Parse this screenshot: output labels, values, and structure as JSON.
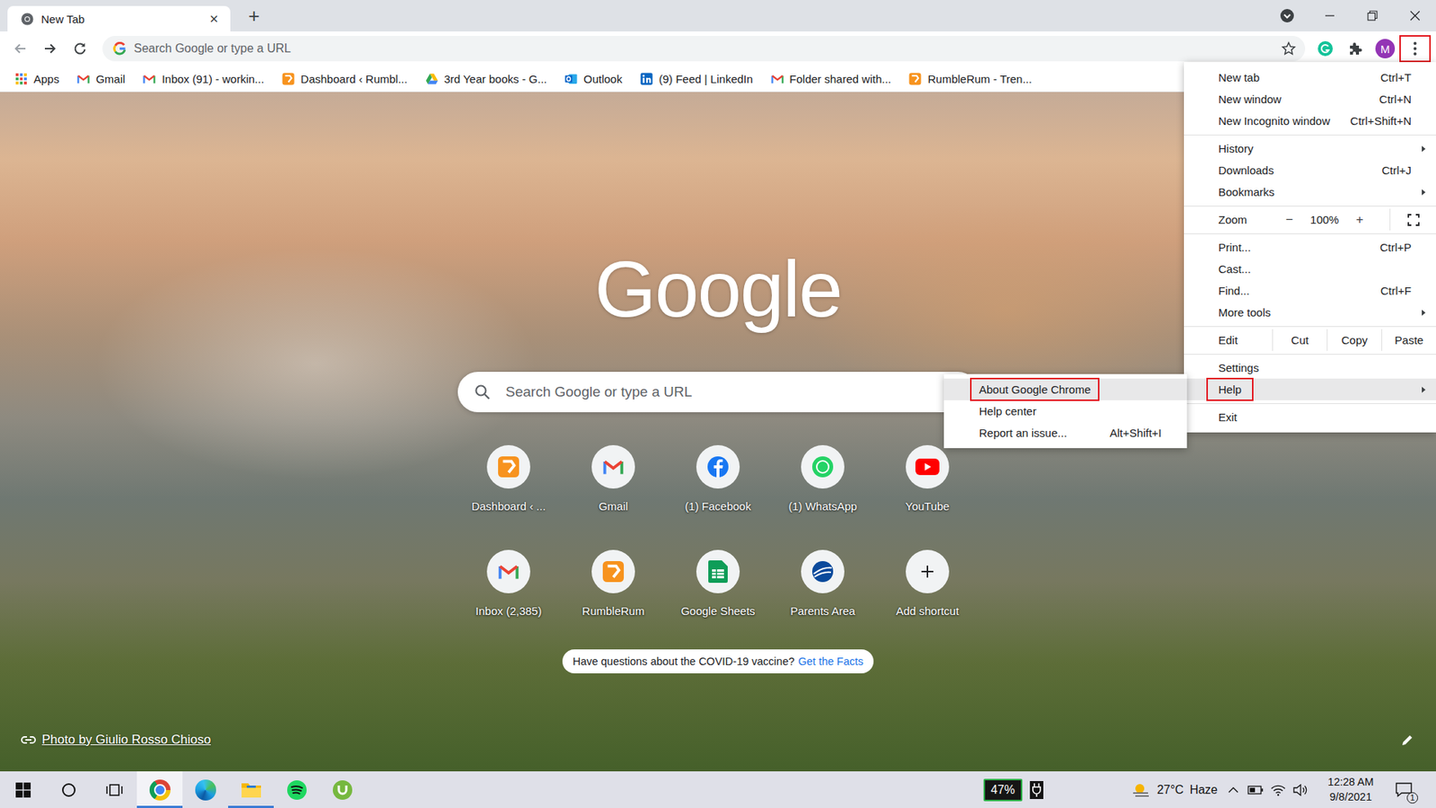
{
  "tabs": [
    {
      "label": "New Tab",
      "selected": true,
      "close": "×"
    }
  ],
  "new_tab": "+",
  "toolbar": {
    "address_placeholder": "Search Google or type a URL",
    "profile": "M",
    "menu_outlined": true
  },
  "bookmarks": [
    {
      "label": "Apps",
      "kind": "apps"
    },
    {
      "label": "Gmail",
      "kind": "gmail"
    },
    {
      "label": "Inbox (91) - workin...",
      "kind": "gmail"
    },
    {
      "label": "Dashboard ‹ Rumbl...",
      "kind": "rumble"
    },
    {
      "label": "3rd Year books - G...",
      "kind": "drive"
    },
    {
      "label": "Outlook",
      "kind": "outlook"
    },
    {
      "label": "(9) Feed | LinkedIn",
      "kind": "linkedin"
    },
    {
      "label": "Folder shared with...",
      "kind": "gmail"
    },
    {
      "label": "RumbleRum - Tren...",
      "kind": "rumble"
    }
  ],
  "new_tab_page": {
    "logo": "Google",
    "search_placeholder": "Search Google or type a URL",
    "shortcuts": [
      {
        "label": "Dashboard ‹ ...",
        "kind": "rumble"
      },
      {
        "label": "Gmail",
        "kind": "gmail"
      },
      {
        "label": "(1) Facebook",
        "kind": "facebook"
      },
      {
        "label": "(1) WhatsApp",
        "kind": "whatsapp"
      },
      {
        "label": "YouTube",
        "kind": "youtube"
      },
      {
        "label": "Inbox (2,385)",
        "kind": "gmail"
      },
      {
        "label": "RumbleRum",
        "kind": "rumble"
      },
      {
        "label": "Google Sheets",
        "kind": "sheets"
      },
      {
        "label": "Parents Area",
        "kind": "parents"
      },
      {
        "label": "Add shortcut",
        "kind": "add"
      }
    ],
    "promo": {
      "text": "Have questions about the COVID-19 vaccine?",
      "link": "Get the Facts"
    },
    "attribution": "Photo by Giulio Rosso Chioso"
  },
  "menu": {
    "items": [
      {
        "kind": "item",
        "label": "New tab",
        "shortcut": "Ctrl+T",
        "submenu": false,
        "highlighted": false,
        "outlined": false
      },
      {
        "kind": "item",
        "label": "New window",
        "shortcut": "Ctrl+N",
        "submenu": false,
        "highlighted": false,
        "outlined": false
      },
      {
        "kind": "item",
        "label": "New Incognito window",
        "shortcut": "Ctrl+Shift+N",
        "submenu": false,
        "highlighted": false,
        "outlined": false
      },
      {
        "kind": "separator"
      },
      {
        "kind": "item",
        "label": "History",
        "shortcut": "",
        "submenu": true,
        "highlighted": false,
        "outlined": false
      },
      {
        "kind": "item",
        "label": "Downloads",
        "shortcut": "Ctrl+J",
        "submenu": false,
        "highlighted": false,
        "outlined": false
      },
      {
        "kind": "item",
        "label": "Bookmarks",
        "shortcut": "",
        "submenu": true,
        "highlighted": false,
        "outlined": false
      },
      {
        "kind": "separator"
      },
      {
        "kind": "zoom",
        "label": "Zoom",
        "minus": "−",
        "value": "100%",
        "plus": "+",
        "highlighted": false,
        "outlined": false
      },
      {
        "kind": "separator"
      },
      {
        "kind": "item",
        "label": "Print...",
        "shortcut": "Ctrl+P",
        "submenu": false,
        "highlighted": false,
        "outlined": false
      },
      {
        "kind": "item",
        "label": "Cast...",
        "shortcut": "",
        "submenu": false,
        "highlighted": false,
        "outlined": false
      },
      {
        "kind": "item",
        "label": "Find...",
        "shortcut": "Ctrl+F",
        "submenu": false,
        "highlighted": false,
        "outlined": false
      },
      {
        "kind": "item",
        "label": "More tools",
        "shortcut": "",
        "submenu": true,
        "highlighted": false,
        "outlined": false
      },
      {
        "kind": "separator"
      },
      {
        "kind": "edit",
        "label": "Edit",
        "actions": [
          "Cut",
          "Copy",
          "Paste"
        ],
        "highlighted": false,
        "outlined": false
      },
      {
        "kind": "separator"
      },
      {
        "kind": "item",
        "label": "Settings",
        "shortcut": "",
        "submenu": false,
        "highlighted": false,
        "outlined": false
      },
      {
        "kind": "item",
        "label": "Help",
        "shortcut": "",
        "submenu": true,
        "highlighted": true,
        "outlined": true
      },
      {
        "kind": "separator"
      },
      {
        "kind": "item",
        "label": "Exit",
        "shortcut": "",
        "submenu": false,
        "highlighted": false,
        "outlined": false
      }
    ]
  },
  "submenu": {
    "items": [
      {
        "label": "About Google Chrome",
        "shortcut": "",
        "highlighted": true,
        "outlined": true
      },
      {
        "label": "Help center",
        "shortcut": "",
        "highlighted": false,
        "outlined": false
      },
      {
        "label": "Report an issue...",
        "shortcut": "Alt+Shift+I",
        "highlighted": false,
        "outlined": false
      }
    ]
  },
  "taskbar": {
    "apps": [
      {
        "kind": "chrome",
        "running": true,
        "active": true
      },
      {
        "kind": "edge",
        "running": false,
        "active": false
      },
      {
        "kind": "explorer",
        "running": true,
        "active": false
      },
      {
        "kind": "spotify",
        "running": false,
        "active": false
      },
      {
        "kind": "utorrent",
        "running": false,
        "active": false
      }
    ],
    "battery": "47%",
    "temperature": "27°C",
    "condition": "Haze",
    "time": "12:28 AM",
    "date": "9/8/2021",
    "notifications": "1"
  }
}
